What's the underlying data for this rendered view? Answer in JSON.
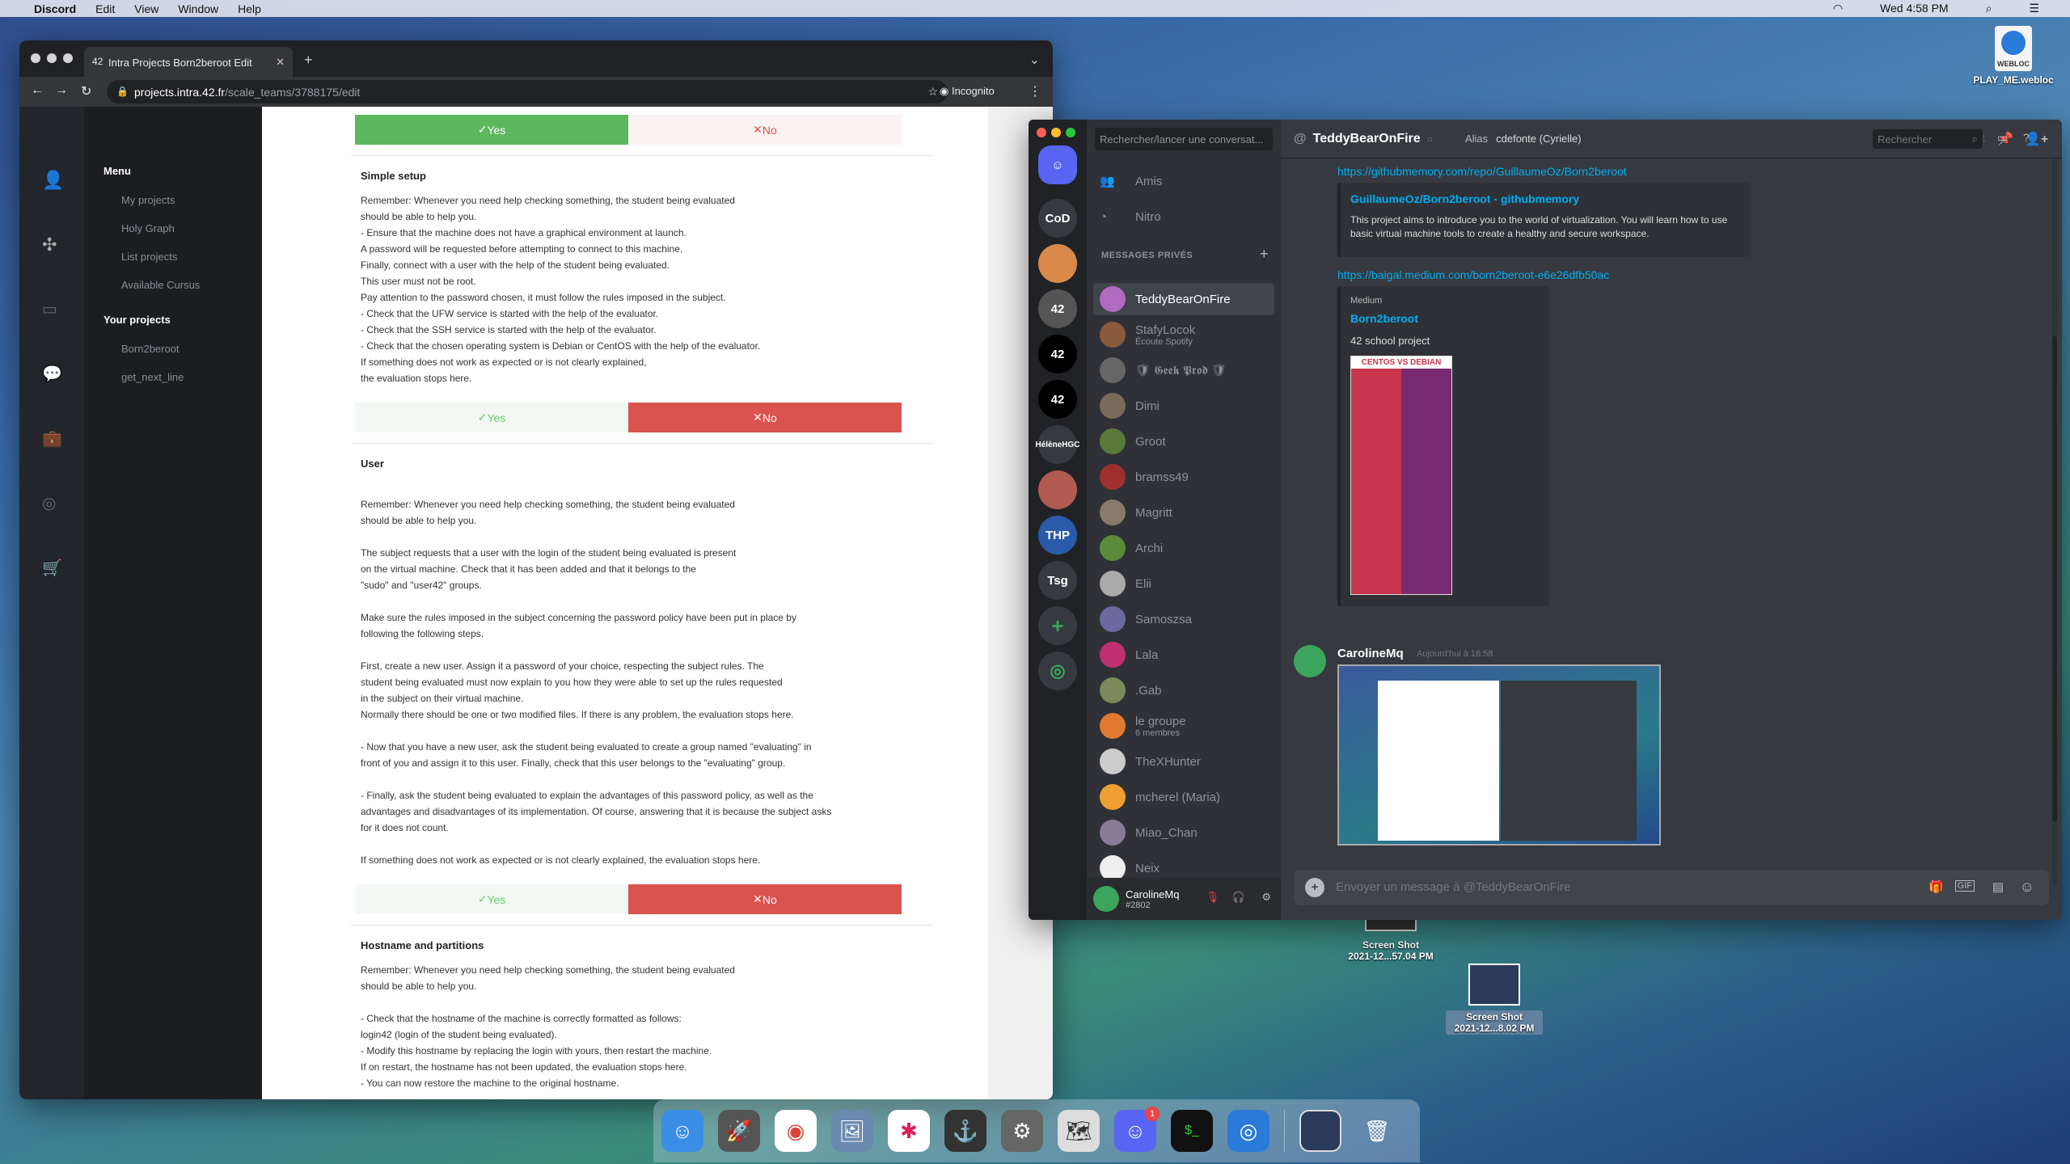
{
  "menubar": {
    "app": "Discord",
    "items": [
      "Edit",
      "View",
      "Window",
      "Help"
    ],
    "clock": "Wed 4:58 PM"
  },
  "browser": {
    "tab_title": "Intra Projects Born2beroot Edit",
    "url_host": "projects.intra.42.fr",
    "url_path": "/scale_teams/3788175/edit",
    "incognito": "Incognito",
    "sidebar": {
      "menu_heading": "Menu",
      "menu_items": [
        "My projects",
        "Holy Graph",
        "List projects",
        "Available Cursus"
      ],
      "projects_heading": "Your projects",
      "projects": [
        "Born2beroot",
        "get_next_line"
      ]
    },
    "yes": "Yes",
    "no": "No",
    "sections": [
      {
        "title": "Simple setup",
        "lines": [
          "Remember: Whenever you need help checking something, the student being evaluated",
          "should be able to help you.",
          "- Ensure that the machine does not have a graphical environment at launch.",
          "A password will be requested before attempting to connect to this machine.",
          "Finally, connect with a user with the help of the student being evaluated.",
          "This user must not be root.",
          "Pay attention to the password chosen, it must follow the rules imposed in the subject.",
          "- Check that the UFW service is started with the help of the evaluator.",
          "- Check that the SSH service is started with the help of the evaluator.",
          "- Check that the chosen operating system is Debian or CentOS with the help of the evaluator.",
          "If something does not work as expected or is not clearly explained,",
          "the evaluation stops here."
        ]
      },
      {
        "title": "User",
        "lines": [
          "",
          "Remember: Whenever you need help checking something, the student being evaluated",
          "should be able to help you.",
          "",
          "The subject requests that a user with the login of the student being evaluated is present",
          "on the virtual machine. Check that it has been added and that it belongs to the",
          "\"sudo\" and \"user42\" groups.",
          "",
          "Make sure the rules imposed in the subject concerning the password policy have been put in place by",
          "following the following steps.",
          "",
          "First, create a new user. Assign it a password of your choice, respecting the subject rules. The",
          "student being evaluated must now explain to you how they were able to set up the rules requested",
          "in the subject on their virtual machine.",
          "Normally there should be one or two modified files. If there is any problem, the evaluation stops here.",
          "",
          "- Now that you have a new user, ask the student being evaluated to create a group named \"evaluating\" in",
          "front of you and assign it to this user. Finally, check that this user belongs to the \"evaluating\" group.",
          "",
          "- Finally, ask the student being evaluated to explain the advantages of this password policy, as well as the",
          "advantages and disadvantages of its implementation. Of course, answering that it is because the subject asks",
          "for it does not count.",
          "",
          "If something does not work as expected or is not clearly explained, the evaluation stops here."
        ]
      },
      {
        "title": "Hostname and partitions",
        "lines": [
          "Remember: Whenever you need help checking something, the student being evaluated",
          "should be able to help you.",
          "",
          "- Check that the hostname of the machine is correctly formatted as follows:",
          "login42 (login of the student being evaluated).",
          "- Modify this hostname by replacing the login with yours, then restart the machine.",
          "If on restart, the hostname has not been updated, the evaluation stops here.",
          "- You can now restore the machine to the original hostname."
        ]
      }
    ]
  },
  "discord": {
    "search_placeholder": "Rechercher/lancer une conversat...",
    "friends": "Amis",
    "nitro": "Nitro",
    "dm_heading": "MESSAGES PRIVÉS",
    "dms": [
      {
        "name": "TeddyBearOnFire",
        "sub": "",
        "color": "#b06ac0"
      },
      {
        "name": "StafyLocok",
        "sub": "Écoute Spotify",
        "color": "#8a5a3c"
      },
      {
        "name": "🛡 𝕲𝖊𝖊𝖐 𝕻𝖗𝖔𝖉 🛡",
        "sub": "",
        "color": "#666"
      },
      {
        "name": "Dimi",
        "sub": "",
        "color": "#7a6a5a"
      },
      {
        "name": "Groot",
        "sub": "",
        "color": "#5a7a3a"
      },
      {
        "name": "bramss49",
        "sub": "",
        "color": "#a03030"
      },
      {
        "name": "Magritt",
        "sub": "",
        "color": "#8a7a6a"
      },
      {
        "name": "Archi",
        "sub": "",
        "color": "#5a8a3a"
      },
      {
        "name": "Elii",
        "sub": "",
        "color": "#aaa"
      },
      {
        "name": "Samoszsa",
        "sub": "",
        "color": "#6a6aa0"
      },
      {
        "name": "Lala",
        "sub": "",
        "color": "#c03070"
      },
      {
        "name": ".Gab",
        "sub": "",
        "color": "#7a8a5a"
      },
      {
        "name": "le groupe",
        "sub": "6 membres",
        "color": "#e07a30"
      },
      {
        "name": "TheXHunter",
        "sub": "",
        "color": "#ccc"
      },
      {
        "name": "mcherel (Maria)",
        "sub": "",
        "color": "#f0a030"
      },
      {
        "name": "Miao_Chan",
        "sub": "",
        "color": "#8a7a9a"
      },
      {
        "name": "Neix",
        "sub": "",
        "color": "#eee"
      }
    ],
    "guild_labels": [
      "CoD",
      "HélèneHGC",
      "Tsg"
    ],
    "user": {
      "name": "CarolineMq",
      "tag": "#2802"
    },
    "header": {
      "name": "TeddyBearOnFire",
      "alias_label": "Alias",
      "alias": "cdefonte (Cyrielle)",
      "search": "Rechercher"
    },
    "messages": {
      "link1": "https://githubmemory.com/repo/GuillaumeOz/Born2beroot",
      "embed1_title": "GuillaumeOz/Born2beroot - githubmemory",
      "embed1_desc": "This project aims to introduce you to the world of virtualization. You will learn how to use basic virtual machine tools to create a healthy and secure workspace.",
      "link2": "https://baigal.medium.com/born2beroot-e6e26dfb50ac",
      "embed2_provider": "Medium",
      "embed2_title": "Born2beroot",
      "embed2_desc": "42 school project",
      "poster_title": "CENTOS VS DEBIAN",
      "author": "CarolineMq",
      "timestamp": "Aujourd'hui à 16:58"
    },
    "input_placeholder": "Envoyer un message à @TeddyBearOnFire"
  },
  "desktop": {
    "webloc": "PLAY_ME.webloc",
    "webloc_badge": "WEBLOC",
    "shots": [
      {
        "title": "Screen Shot",
        "date": "2021-12...57.04 PM"
      },
      {
        "title": "Screen Shot",
        "date": "2021-12...8.02 PM"
      }
    ]
  },
  "dock": {
    "discord_badge": "1"
  }
}
